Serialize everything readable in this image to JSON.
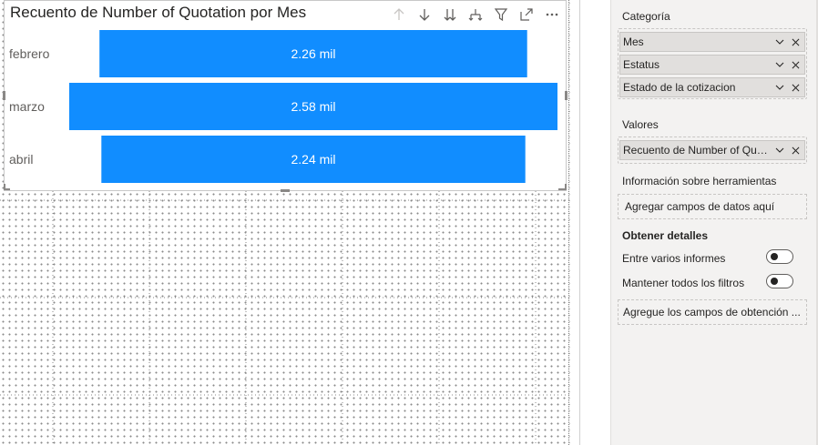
{
  "visual": {
    "title": "Recuento de Number of Quotation por Mes",
    "toolbar_icons": [
      "arrow-up-icon",
      "arrow-down-icon",
      "double-arrow-down-icon",
      "expand-hierarchy-icon",
      "filter-icon",
      "focus-mode-icon",
      "more-options-icon"
    ]
  },
  "chart_data": {
    "type": "bar",
    "orientation": "horizontal-funnel",
    "categories": [
      "febrero",
      "marzo",
      "abril"
    ],
    "values": [
      2260,
      2580,
      2240
    ],
    "data_labels": [
      "2.26 mil",
      "2.58 mil",
      "2.24 mil"
    ],
    "title": "Recuento de Number of Quotation por Mes",
    "bar_color": "#118DFF",
    "label_color": "#FFFFFF"
  },
  "fields_pane": {
    "categoria_label": "Categoría",
    "categoria_fields": [
      "Mes",
      "Estatus",
      "Estado de la cotizacion"
    ],
    "valores_label": "Valores",
    "valores_fields": [
      "Recuento de Number of Quot..."
    ],
    "tooltips_label": "Información sobre herramientas",
    "tooltips_placeholder": "Agregar campos de datos aquí",
    "drillthrough_label": "Obtener detalles",
    "cross_report_label": "Entre varios informes",
    "keep_filters_label": "Mantener todos los filtros",
    "cross_report_state": "Desactivado",
    "keep_filters_state": "Desactivado",
    "drillthrough_placeholder": "Agregue los campos de obtención ..."
  },
  "colors": {
    "accent": "#118DFF",
    "pane_bg": "#F3F2F1",
    "field_bg": "#E1DFDD"
  }
}
